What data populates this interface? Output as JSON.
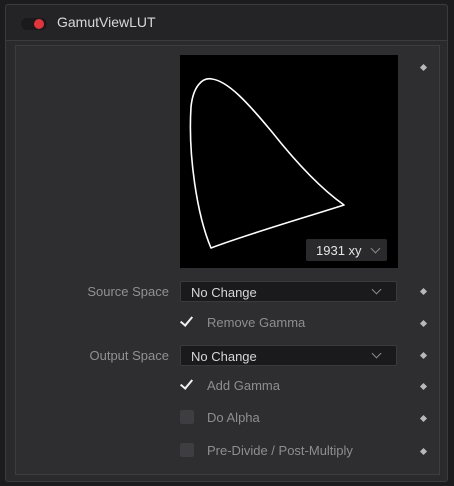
{
  "node": {
    "title": "GamutViewLUT",
    "enabled": true,
    "accent_color": "#e4343b"
  },
  "gamut_view": {
    "diagram_label": "1931 xy",
    "icon": "chevron-down-icon"
  },
  "controls": {
    "source_space": {
      "label": "Source Space",
      "value": "No Change"
    },
    "remove_gamma": {
      "label": "Remove Gamma",
      "checked": true
    },
    "output_space": {
      "label": "Output Space",
      "value": "No Change"
    },
    "add_gamma": {
      "label": "Add Gamma",
      "checked": true
    },
    "do_alpha": {
      "label": "Do Alpha",
      "checked": false
    },
    "pre_divide": {
      "label": "Pre-Divide / Post-Multiply",
      "checked": false
    }
  },
  "icons": {
    "keyframe": "diamond-icon",
    "checkbox": "checkmark-icon"
  }
}
